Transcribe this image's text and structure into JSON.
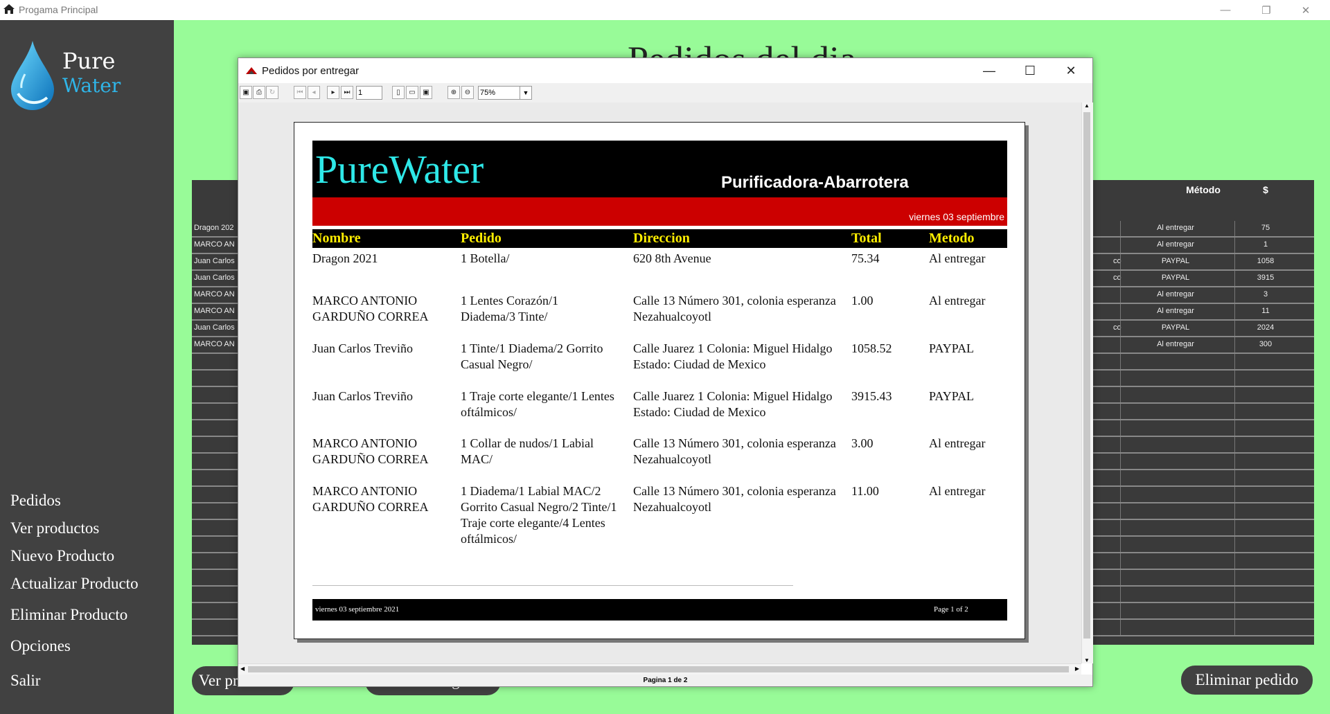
{
  "outer_window": {
    "title": "Progama Principal"
  },
  "brand": {
    "pure": "Pure",
    "water": "Water"
  },
  "sidebar": {
    "items": [
      "Pedidos",
      "Ver productos",
      "Nuevo Producto",
      "Actualizar Producto",
      "Eliminar Producto",
      "Opciones",
      "Salir"
    ]
  },
  "main": {
    "heading": "Pedidos del dia",
    "table": {
      "headers": {
        "metodo": "Método",
        "total": "$"
      },
      "rows": [
        {
          "nombre": "Dragon 202",
          "extra": "",
          "metodo": "Al entregar",
          "total": "75"
        },
        {
          "nombre": "MARCO AN",
          "extra": "",
          "metodo": "Al entregar",
          "total": "1"
        },
        {
          "nombre": "Juan Carlos",
          "extra": "co",
          "metodo": "PAYPAL",
          "total": "1058"
        },
        {
          "nombre": "Juan Carlos",
          "extra": "co",
          "metodo": "PAYPAL",
          "total": "3915"
        },
        {
          "nombre": "MARCO AN",
          "extra": "",
          "metodo": "Al entregar",
          "total": "3"
        },
        {
          "nombre": "MARCO AN",
          "extra": "",
          "metodo": "Al entregar",
          "total": "11"
        },
        {
          "nombre": "Juan Carlos",
          "extra": "co",
          "metodo": "PAYPAL",
          "total": "2024"
        },
        {
          "nombre": "MARCO AN",
          "extra": "",
          "metodo": "Al entregar",
          "total": "300"
        }
      ]
    },
    "buttons": {
      "ver": "Ver productos",
      "por_entregar": "Por entregar",
      "eliminar": "Eliminar pedido"
    }
  },
  "dialog": {
    "title": "Pedidos por entregar",
    "toolbar": {
      "page": "1",
      "zoom": "75%"
    },
    "status": "Pagina 1 de 2",
    "report": {
      "brand": "PureWater",
      "subtitle": "Purificadora-Abarrotera",
      "date": "viernes 03 septiembre",
      "columns": {
        "nombre": "Nombre",
        "pedido": "Pedido",
        "direccion": "Direccion",
        "total": "Total",
        "metodo": "Metodo"
      },
      "rows": [
        {
          "nombre": "Dragon 2021",
          "pedido": "1 Botella/",
          "direccion": "620 8th Avenue",
          "total": "75.34",
          "metodo": "Al entregar"
        },
        {
          "nombre": "MARCO ANTONIO GARDUÑO CORREA",
          "pedido": "1 Lentes Corazón/1 Diadema/3 Tinte/",
          "direccion": "Calle 13 Número 301, colonia esperanza Nezahualcoyotl",
          "total": "1.00",
          "metodo": "Al entregar"
        },
        {
          "nombre": "Juan Carlos Treviño",
          "pedido": "1 Tinte/1 Diadema/2 Gorrito Casual Negro/",
          "direccion": "Calle Juarez 1 Colonia: Miguel Hidalgo Estado: Ciudad de Mexico",
          "total": "1058.52",
          "metodo": "PAYPAL"
        },
        {
          "nombre": "Juan Carlos Treviño",
          "pedido": "1 Traje corte elegante/1 Lentes oftálmicos/",
          "direccion": "Calle Juarez 1 Colonia: Miguel Hidalgo Estado: Ciudad de Mexico",
          "total": "3915.43",
          "metodo": "PAYPAL"
        },
        {
          "nombre": "MARCO ANTONIO GARDUÑO CORREA",
          "pedido": "1 Collar de nudos/1 Labial MAC/",
          "direccion": "Calle 13 Número 301, colonia esperanza Nezahualcoyotl",
          "total": "3.00",
          "metodo": "Al entregar"
        },
        {
          "nombre": "MARCO ANTONIO GARDUÑO CORREA",
          "pedido": "1 Diadema/1 Labial MAC/2 Gorrito Casual Negro/2 Tinte/1 Traje corte elegante/4 Lentes oftálmicos/",
          "direccion": "Calle 13 Número 301, colonia esperanza Nezahualcoyotl",
          "total": "11.00",
          "metodo": "Al entregar"
        }
      ],
      "footer": {
        "date": "viernes 03 septiembre 2021",
        "page": "Page 1 of 2"
      }
    }
  },
  "colors": {
    "green": "#98fb98",
    "sidebar": "#414141",
    "brand_cyan": "#2ee8e8",
    "header_red": "#cc0000",
    "col_yellow": "#ffee00"
  }
}
